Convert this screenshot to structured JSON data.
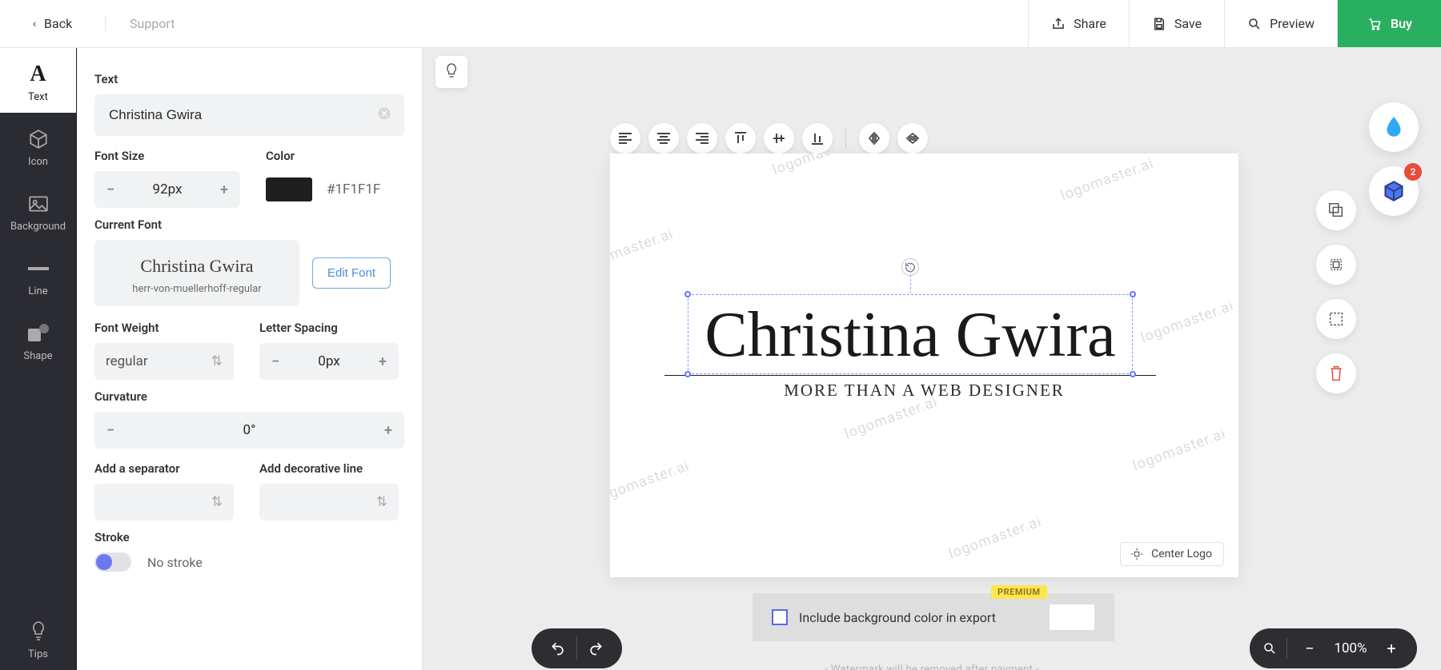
{
  "topbar": {
    "back": "Back",
    "support": "Support",
    "share": "Share",
    "save": "Save",
    "preview": "Preview",
    "buy": "Buy"
  },
  "sidebar": [
    {
      "key": "text",
      "label": "Text"
    },
    {
      "key": "icon",
      "label": "Icon"
    },
    {
      "key": "background",
      "label": "Background"
    },
    {
      "key": "line",
      "label": "Line"
    },
    {
      "key": "shape",
      "label": "Shape"
    },
    {
      "key": "tips",
      "label": "Tips"
    }
  ],
  "panel": {
    "text_label": "Text",
    "text_value": "Christina Gwira",
    "font_size_label": "Font Size",
    "font_size_value": "92px",
    "color_label": "Color",
    "color_hex": "#1F1F1F",
    "current_font_label": "Current Font",
    "font_preview_name": "Christina Gwira",
    "font_file_name": "herr-von-muellerhoff-regular",
    "edit_font": "Edit Font",
    "font_weight_label": "Font Weight",
    "font_weight_value": "regular",
    "letter_spacing_label": "Letter Spacing",
    "letter_spacing_value": "0px",
    "curvature_label": "Curvature",
    "curvature_value": "0°",
    "add_separator_label": "Add a separator",
    "add_decorative_line_label": "Add decorative line",
    "stroke_label": "Stroke",
    "stroke_value": "No stroke"
  },
  "canvas": {
    "logo_main": "Christina Gwira",
    "logo_sub": "MORE THAN A WEB DESIGNER",
    "watermark_text": "logomaster.ai",
    "center_logo_btn": "Center Logo"
  },
  "footer": {
    "include_bg_label": "Include background color in export",
    "premium_tag": "PREMIUM",
    "watermark_note": "- Watermark will be removed after payment -"
  },
  "zoom": {
    "value": "100%"
  },
  "right_sidebar": {
    "layer_badge": "2"
  }
}
